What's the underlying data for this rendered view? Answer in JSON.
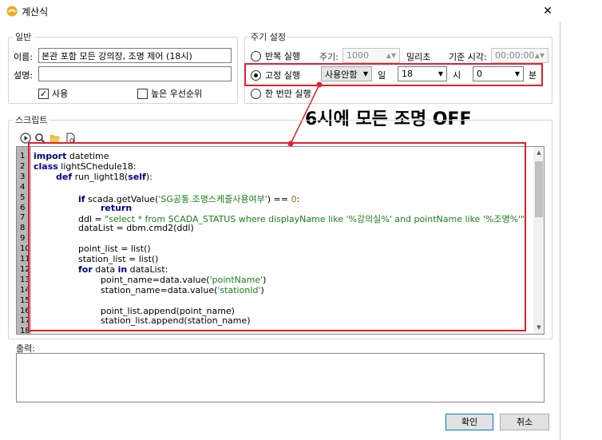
{
  "window": {
    "title": "계산식"
  },
  "general": {
    "section": "일반",
    "name_label": "이름:",
    "name_value": "본관 포함 모든 강의장, 조명 제어 (18시)",
    "desc_label": "설명:",
    "desc_value": "",
    "use_label": "사용",
    "use_checked": "✓",
    "priority_label": "높은 우선순위"
  },
  "schedule": {
    "section": "주기 설정",
    "repeat_label": "반복 실행",
    "period_label": "주기:",
    "period_value": "1000",
    "ms_label": "밀리초",
    "base_time_label": "기준 시각:",
    "base_time_value": "00:00:00",
    "fixed_label": "고정 실행",
    "day_select": "사용안함",
    "day_label": "일",
    "hour_select": "18",
    "hour_label": "시",
    "minute_select": "0",
    "minute_label": "분",
    "once_label": "한 번만 실행"
  },
  "annotation": "6시에 모든 조명 OFF",
  "script": {
    "section": "스크립트",
    "line_numbers": [
      "1",
      "2",
      "3",
      "4",
      "5",
      "6",
      "7",
      "8",
      "9",
      "10",
      "11",
      "12",
      "13",
      "14",
      "15",
      "16",
      "17",
      "18"
    ],
    "lines": [
      {
        "kw": "import",
        "rest": " datetime"
      },
      {
        "kw": "class",
        "rest": " lightSChedule18:"
      },
      {
        "kw": "def",
        "rest": " run_light18(",
        "kw2": "self",
        "rest2": "):"
      },
      {
        "text": ""
      },
      {
        "pre": "if",
        "text": " scada.getValue(",
        "str": "'SG공통.조명스케줄사용여부'",
        "post": ") == ",
        "num": "0",
        "end": ":"
      },
      {
        "kw": "return",
        "rest": ""
      },
      {
        "pre2": "ddl = ",
        "str": "\"select * from SCADA_STATUS where displayName like '%강의실%' and pointName like '%조명%'\""
      },
      {
        "text": "dataList = dbm.cmd2(ddl)"
      },
      {
        "text": ""
      },
      {
        "text": "point_list = list()"
      },
      {
        "text": "station_list = list()"
      },
      {
        "pre": "for",
        "text": " data ",
        "kw2": "in",
        "rest2": " dataList:"
      },
      {
        "text": "point_name=data.value(",
        "str": "'pointName'",
        "post": ")"
      },
      {
        "text": "station_name=data.value(",
        "str": "'stationId'",
        "post": ")"
      },
      {
        "text": ""
      },
      {
        "text": "point_list.append(point_name)"
      },
      {
        "text": "station_list.append(station_name)"
      },
      {
        "text": ""
      }
    ]
  },
  "output": {
    "section": "출력:"
  },
  "buttons": {
    "ok": "확인",
    "cancel": "취소"
  },
  "colors": {
    "highlight": "#e2202f",
    "keyword": "#00008b",
    "string": "#1a7f1a",
    "number": "#b06000"
  }
}
